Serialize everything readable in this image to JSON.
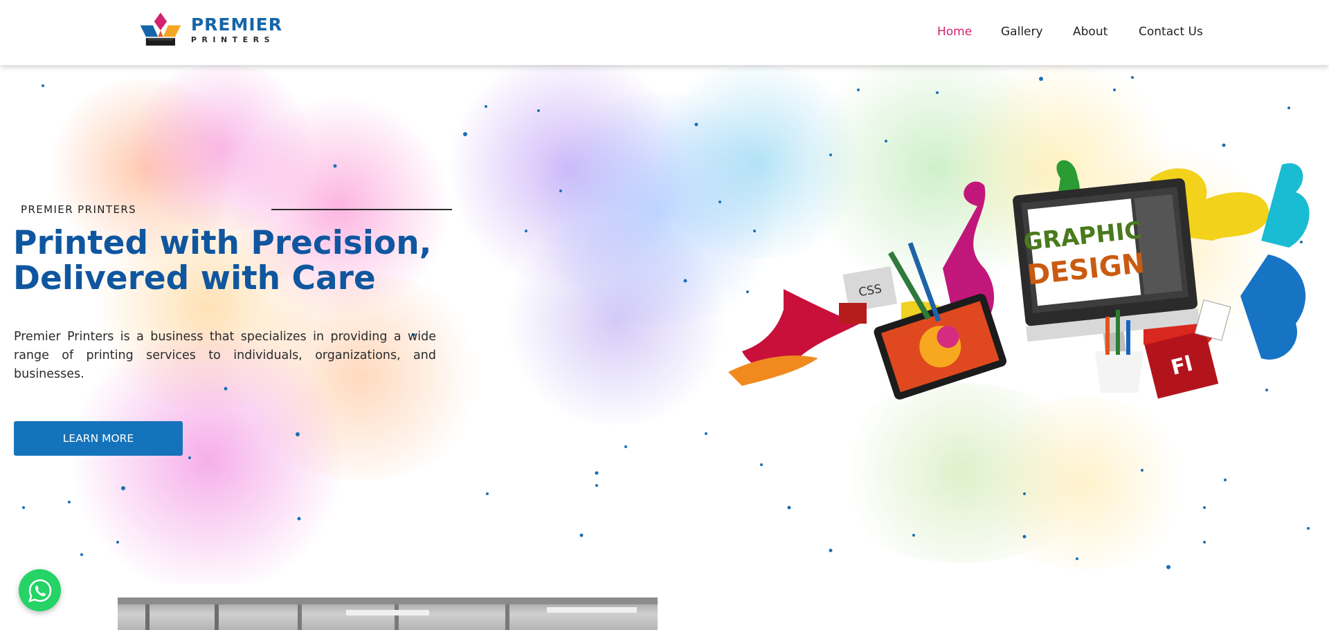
{
  "brand": {
    "name_line1": "PREMIER",
    "name_line2": "PRINTERS",
    "colors": {
      "primary_blue": "#1565a8",
      "headline_blue": "#0f569f",
      "accent_pink": "#d2236f",
      "button_blue": "#1573bb",
      "whatsapp_green": "#25d366"
    },
    "logo_icon": "crown-printer-logo-icon"
  },
  "nav": {
    "items": [
      {
        "label": "Home",
        "active": true
      },
      {
        "label": "Gallery",
        "active": false
      },
      {
        "label": "About",
        "active": false
      },
      {
        "label": "Contact Us",
        "active": false
      }
    ]
  },
  "hero": {
    "eyebrow": "PREMIER PRINTERS",
    "headline_line1": "Printed with Precision,",
    "headline_line2": "Delivered with Care",
    "description": "Premier Printers is a business that specializes in providing a wide range of printing services to individuals, organizations, and businesses.",
    "cta_label": "LEARN MORE",
    "image_text_line1": "GRAPHIC",
    "image_text_line2": "DESIGN",
    "image_badge_css": "CSS",
    "image_badge_fl": "Fl"
  },
  "floating": {
    "whatsapp_icon": "whatsapp-icon"
  }
}
